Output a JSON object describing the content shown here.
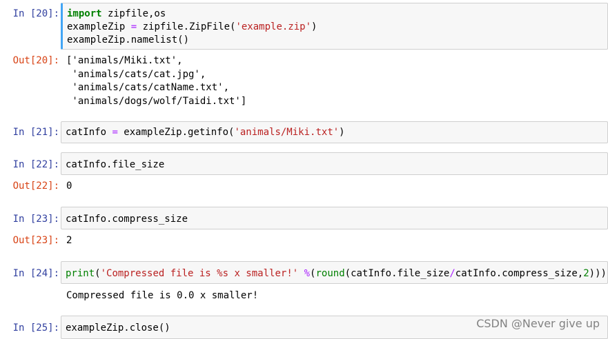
{
  "cells": [
    {
      "in_prompt": "In  [20]:",
      "out_prompt": "Out[20]:",
      "code": [
        {
          "kw": "import",
          "rest": " zipfile,os"
        },
        {
          "a": "exampleZip ",
          "op": "=",
          "b": " zipfile.ZipFile(",
          "str": "'example.zip'",
          "c": ")"
        },
        {
          "text": "exampleZip.namelist()"
        }
      ],
      "output": [
        "['animals/Miki.txt',",
        " 'animals/cats/cat.jpg',",
        " 'animals/cats/catName.txt',",
        " 'animals/dogs/wolf/Taidi.txt']"
      ]
    },
    {
      "in_prompt": "In  [21]:",
      "code": [
        {
          "a": "catInfo ",
          "op": "=",
          "b": " exampleZip.getinfo(",
          "str": "'animals/Miki.txt'",
          "c": ")"
        }
      ]
    },
    {
      "in_prompt": "In  [22]:",
      "out_prompt": "Out[22]:",
      "code": [
        {
          "text": "catInfo.file_size"
        }
      ],
      "output": [
        "0"
      ]
    },
    {
      "in_prompt": "In  [23]:",
      "out_prompt": "Out[23]:",
      "code": [
        {
          "text": "catInfo.compress_size"
        }
      ],
      "output": [
        "2"
      ]
    },
    {
      "in_prompt": "In  [24]:",
      "code": [
        {
          "bi": "print",
          "p1": "(",
          "str": "'Compressed file is %s x smaller!'",
          "sp": " ",
          "op": "%",
          "p2": "(",
          "bi2": "round",
          "p3": "(catInfo.file_size",
          "op2": "/",
          "p4": "catInfo.compress_size,",
          "num": "2",
          "p5": ")))"
        }
      ],
      "stdout": [
        "Compressed file is 0.0 x smaller!"
      ]
    },
    {
      "in_prompt": "In  [25]:",
      "code": [
        {
          "text": "exampleZip.close()"
        }
      ]
    }
  ],
  "watermark": "CSDN @Never  give  up"
}
